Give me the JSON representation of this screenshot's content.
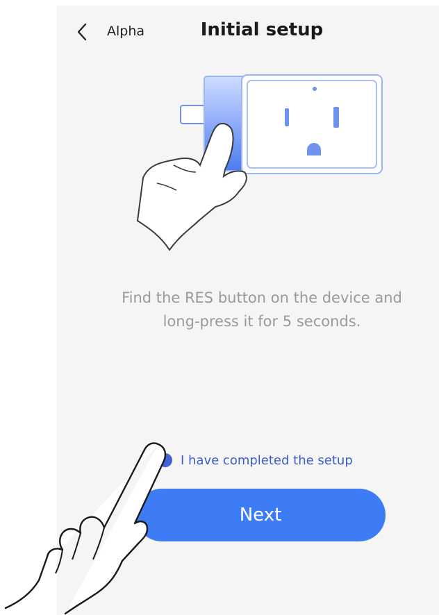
{
  "header": {
    "back_label": "Alpha",
    "title": "Initial setup"
  },
  "main": {
    "instruction_line1": "Find the RES button on the device and",
    "instruction_line2": "long-press it for 5 seconds.",
    "checkbox_label": "I have completed the setup",
    "checkbox_checked": true,
    "next_label": "Next"
  },
  "icons": {
    "back": "chevron-left-icon",
    "illustration": "smart-plug-illustration",
    "pointer": "pointing-hand-icon"
  },
  "colors": {
    "accent": "#3d7cf5",
    "check": "#3f63d4",
    "background": "#f5f5f5",
    "instruction_text": "#9a9a9a"
  }
}
